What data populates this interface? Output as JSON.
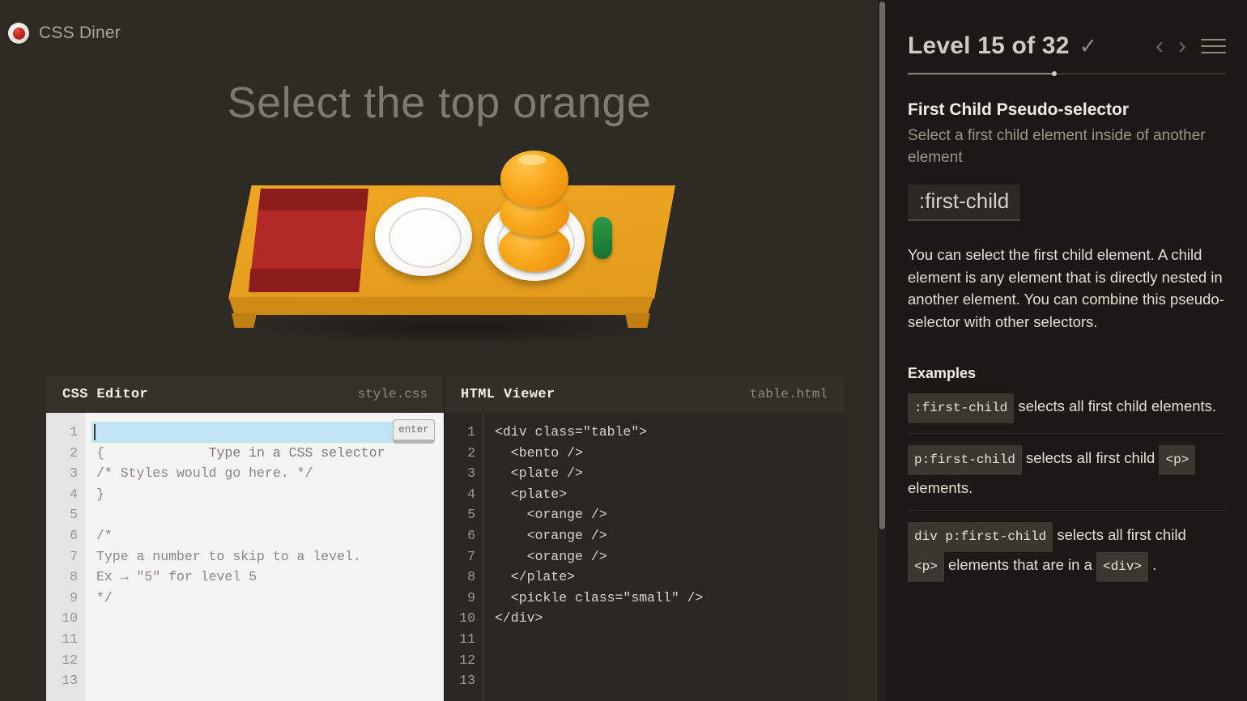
{
  "brand": {
    "name": "CSS Diner",
    "logo_icon": "cherry-plate-icon"
  },
  "level": {
    "title": "Select the top orange",
    "counter": "Level 15 of 32",
    "check_icon": "✓",
    "prev_icon": "‹",
    "next_icon": "›",
    "menu_icon": "hamburger-menu-icon",
    "progress_percent": 46
  },
  "scene": {
    "items": [
      "bento",
      "plate",
      "plate-with-oranges",
      "orange",
      "orange",
      "orange",
      "pickle"
    ],
    "colors": {
      "table": "#e8a01f",
      "table_front": "#d08b16",
      "bento": "#b22a28",
      "plate": "#ffffff",
      "orange": "#f9a81b",
      "pickle": "#1f8239"
    }
  },
  "css_editor": {
    "title": "CSS Editor",
    "filename": "style.css",
    "input_value": "",
    "input_placeholder": "Type in a CSS selector",
    "enter_label": "enter",
    "gutter": [
      "1",
      "2",
      "3",
      "4",
      "5",
      "6",
      "7",
      "8",
      "9",
      "10",
      "11",
      "12",
      "13"
    ],
    "lines": [
      "{",
      "/* Styles would go here. */",
      "}",
      "",
      "/*",
      "Type a number to skip to a level.",
      "Ex → \"5\" for level 5",
      "*/",
      "",
      "",
      "",
      ""
    ]
  },
  "html_viewer": {
    "title": "HTML Viewer",
    "filename": "table.html",
    "gutter": [
      "1",
      "2",
      "3",
      "4",
      "5",
      "6",
      "7",
      "8",
      "9",
      "10",
      "11",
      "12",
      "13"
    ],
    "lines": [
      "<div class=\"table\">",
      "  <bento />",
      "  <plate />",
      "  <plate>",
      "    <orange />",
      "    <orange />",
      "    <orange />",
      "  </plate>",
      "  <pickle class=\"small\" />",
      "</div>",
      "",
      "",
      ""
    ]
  },
  "help": {
    "selector_name": "First Child Pseudo-selector",
    "selector_description": "Select a first child element inside of another element",
    "selector_code": ":first-child",
    "explanation": "You can select the first child element. A child element is any element that is directly nested in another element. You can combine this pseudo-selector with other selectors.",
    "examples_title": "Examples",
    "examples": [
      {
        "code": ":first-child",
        "text_before": "",
        "text_after": " selects all first child elements."
      },
      {
        "code": "p:first-child",
        "text_before": "",
        "text_mid": " selects all first child ",
        "chip2": "<p>",
        "text_after": " elements."
      },
      {
        "code": "div p:first-child",
        "text_before": "",
        "text_mid": " selects all first child ",
        "chip2": "<p>",
        "text_mid2": " elements that are in a ",
        "chip3": "<div>",
        "text_after": " ."
      }
    ]
  }
}
